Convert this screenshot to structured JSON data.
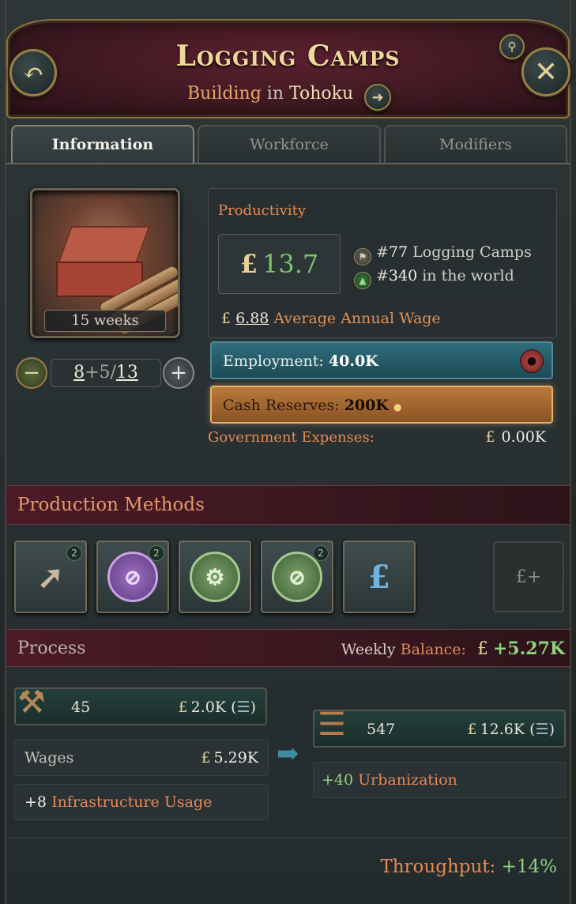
{
  "header": {
    "title": "Logging Camps",
    "subtitle_type": "Building",
    "subtitle_in": "in",
    "subtitle_place": "Tohoku"
  },
  "tabs": [
    {
      "label": "Information",
      "active": true
    },
    {
      "label": "Workforce",
      "active": false
    },
    {
      "label": "Modifiers",
      "active": false
    }
  ],
  "building": {
    "construction_time": "15 weeks",
    "level_current": "8",
    "level_queued": "+5",
    "level_sep": "/",
    "level_max": "13"
  },
  "productivity": {
    "label": "Productivity",
    "currency": "£",
    "value": "13.7",
    "rank_type_prefix": "#",
    "rank_type_num": "77",
    "rank_type_text": "Logging Camps",
    "rank_world_prefix": "#",
    "rank_world_num": "340",
    "rank_world_text": "in the world",
    "wage_value": "6.88",
    "wage_label": "Average Annual Wage"
  },
  "employment": {
    "label": "Employment:",
    "value": "40.0K"
  },
  "cash": {
    "label": "Cash Reserves:",
    "value": "200K"
  },
  "government": {
    "label": "Government Expenses:",
    "currency": "£",
    "value": "0.00K"
  },
  "production_methods": {
    "title": "Production Methods",
    "items": [
      {
        "name": "saw-icon",
        "badge": "2"
      },
      {
        "name": "no-forestry-icon",
        "badge": "2"
      },
      {
        "name": "no-automation-icon",
        "badge": ""
      },
      {
        "name": "no-rail-icon",
        "badge": "2"
      },
      {
        "name": "ownership-icon",
        "badge": ""
      }
    ],
    "empty_slot": "£+"
  },
  "process": {
    "title": "Process",
    "balance_label_1": "Weekly",
    "balance_label_2": "Balance:",
    "balance_currency": "£",
    "balance_value": "+5.27K",
    "input": {
      "count": "45",
      "currency": "£",
      "price": "2.0K",
      "open": "(",
      "close": ")"
    },
    "output": {
      "count": "547",
      "currency": "£",
      "price": "12.6K",
      "open": "(",
      "close": ")"
    },
    "wages_label": "Wages",
    "wages_currency": "£",
    "wages_value": "5.29K",
    "infra_value": "+8",
    "infra_label": "Infrastructure Usage",
    "urban_value": "+40",
    "urban_label": "Urbanization",
    "throughput_label": "Throughput:",
    "throughput_value": "+14%"
  },
  "colors": {
    "accent_orange": "#e68a55",
    "positive_green": "#8fd27f",
    "gold": "#e7cf9a",
    "header_maroon": "#4b1a26",
    "employment_teal": "#2f6d7c",
    "cash_orange": "#b97a3b"
  }
}
